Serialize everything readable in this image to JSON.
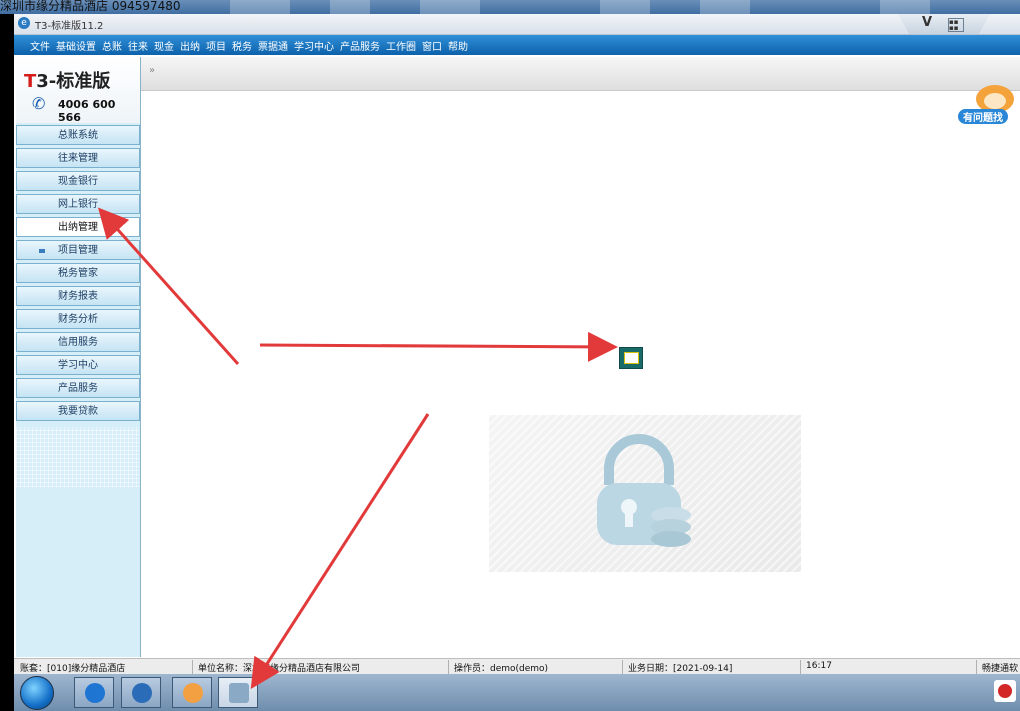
{
  "top_caption": "深圳市缘分精品酒店 094597480",
  "window": {
    "title": "T3-标准版11.2"
  },
  "menu": [
    "文件",
    "基础设置",
    "总账",
    "往来",
    "现金",
    "出纳",
    "项目",
    "税务",
    "票据通",
    "学习中心",
    "产品服务",
    "工作圈",
    "窗口",
    "帮助"
  ],
  "logo": {
    "brand_red": "T",
    "brand_rest": "3-标准版",
    "phone": "4006 600 566"
  },
  "nav": [
    {
      "label": "总账系统"
    },
    {
      "label": "往来管理"
    },
    {
      "label": "现金银行"
    },
    {
      "label": "网上银行"
    },
    {
      "label": "出纳管理"
    },
    {
      "label": "项目管理"
    },
    {
      "label": "税务管家"
    },
    {
      "label": "财务报表"
    },
    {
      "label": "财务分析"
    },
    {
      "label": "信用服务"
    },
    {
      "label": "学习中心"
    },
    {
      "label": "产品服务"
    },
    {
      "label": "我要贷款"
    }
  ],
  "tabstrip": {
    "chevron": "»"
  },
  "mascot": {
    "label": "有问题找"
  },
  "status": {
    "account": "账套：[010]缘分精品酒店",
    "unit": "单位名称：深圳市缘分精品酒店有限公司",
    "operator": "操作员：demo(demo)",
    "business_date": "业务日期：[2021-09-14]",
    "time": "16:17",
    "right": "畅捷通软"
  },
  "colors": {
    "menubar": "#0d62ab",
    "sidebar": "#d6eef8",
    "arrow": "#e23a3a"
  }
}
